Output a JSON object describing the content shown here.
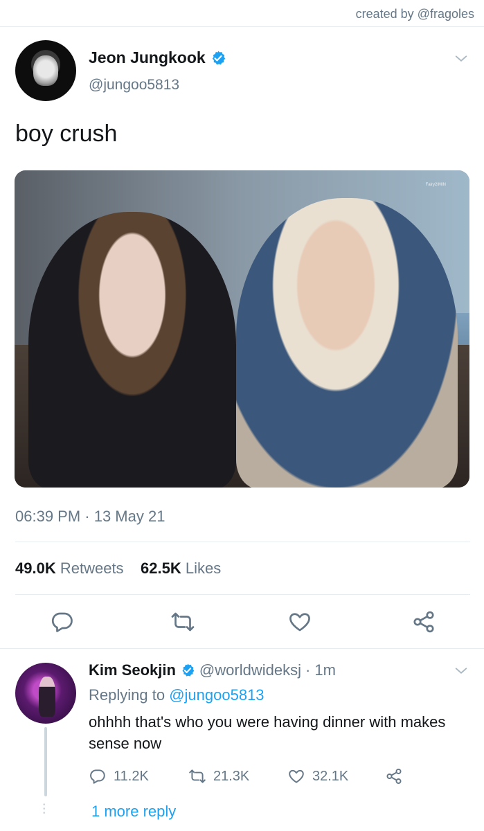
{
  "credit": "created by @fragoles",
  "tweet": {
    "author_name": "Jeon Jungkook",
    "author_handle": "@jungoo5813",
    "text": "boy crush",
    "photo_watermark": "Fairy2IMIN",
    "timestamp": "06:39 PM · 13 May 21",
    "retweets_count": "49.0K",
    "retweets_label": "Retweets",
    "likes_count": "62.5K",
    "likes_label": "Likes"
  },
  "reply": {
    "author_name": "Kim Seokjin",
    "author_handle": "@worldwideksj",
    "time": "· 1m",
    "replying_prefix": "Replying to",
    "replying_to": "@jungoo5813",
    "text": "ohhhh that's who you were having dinner with makes sense now",
    "reply_count": "11.2K",
    "retweet_count": "21.3K",
    "like_count": "32.1K"
  },
  "more_replies": "1 more reply",
  "icons": [
    "verified-badge-icon",
    "chevron-down-icon",
    "reply-icon",
    "retweet-icon",
    "like-icon",
    "share-icon"
  ],
  "colors": {
    "link": "#1da1f2",
    "muted": "#657786",
    "text": "#14171a",
    "divider": "#e6ecf0"
  }
}
